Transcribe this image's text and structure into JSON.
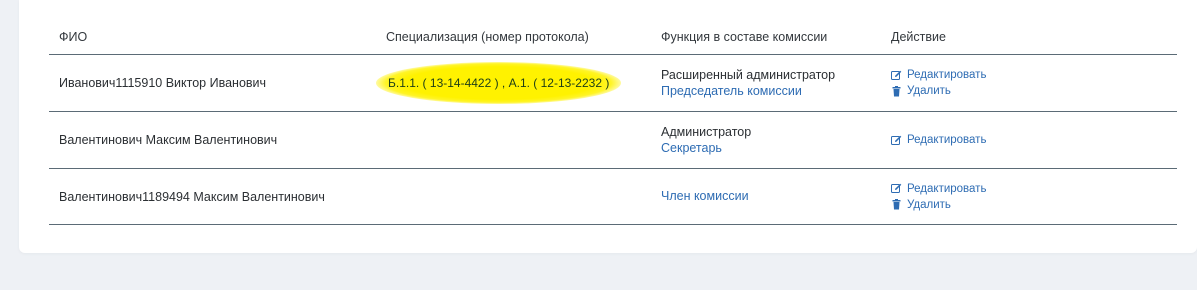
{
  "table": {
    "headers": {
      "fio": "ФИО",
      "specialization": "Специализация (номер протокола)",
      "function": "Функция в составе комиссии",
      "action": "Действие"
    },
    "rows": [
      {
        "name": "Иванович1115910 Виктор Иванович",
        "specialization": "Б.1.1. ( 13-14-4422 ) , А.1. ( 12-13-2232 )",
        "role": "Расширенный администратор",
        "function_link": "Председатель комиссии",
        "edit_label": "Редактировать",
        "delete_label": "Удалить"
      },
      {
        "name": "Валентинович Максим Валентинович",
        "specialization": "",
        "role": "Администратор",
        "function_link": "Секретарь",
        "edit_label": "Редактировать"
      },
      {
        "name": "Валентинович1189494 Максим Валентинович",
        "specialization": "",
        "role": "",
        "function_link": "Член комиссии",
        "edit_label": "Редактировать",
        "delete_label": "Удалить"
      }
    ]
  },
  "colors": {
    "link": "#2e6cb3",
    "highlight": "#fff200",
    "text": "#2b2f33",
    "divider": "#5b6b76"
  },
  "icons": {
    "edit": "edit-icon",
    "delete": "trash-icon"
  }
}
